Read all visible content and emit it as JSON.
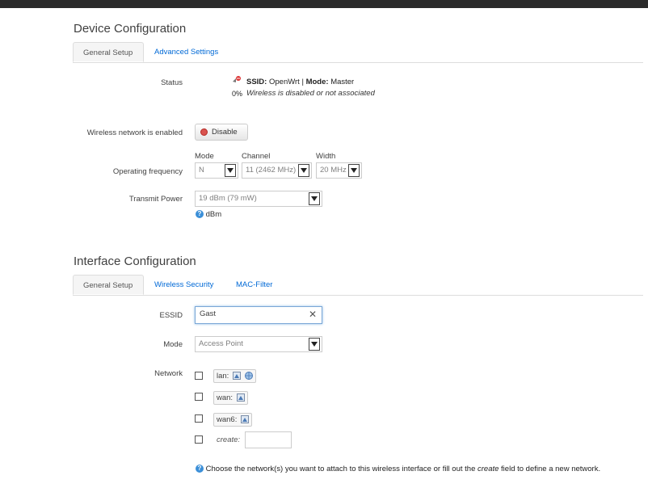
{
  "device": {
    "title": "Device Configuration",
    "tabs": [
      "General Setup",
      "Advanced Settings"
    ],
    "status": {
      "label": "Status",
      "ssid_label": "SSID:",
      "ssid_value": "OpenWrt",
      "sep": "|",
      "mode_label": "Mode:",
      "mode_value": "Master",
      "signal": "0%",
      "message": "Wireless is disabled or not associated"
    },
    "enabled": {
      "label": "Wireless network is enabled",
      "button": "Disable"
    },
    "frequency": {
      "label": "Operating frequency",
      "mode_label": "Mode",
      "mode_value": "N",
      "channel_label": "Channel",
      "channel_value": "11 (2462 MHz)",
      "width_label": "Width",
      "width_value": "20 MHz"
    },
    "transmit": {
      "label": "Transmit Power",
      "value": "19 dBm (79 mW)",
      "hint": "dBm"
    }
  },
  "interface": {
    "title": "Interface Configuration",
    "tabs": [
      "General Setup",
      "Wireless Security",
      "MAC-Filter"
    ],
    "essid": {
      "label": "ESSID",
      "value": "Gast",
      "clear": "✕"
    },
    "mode": {
      "label": "Mode",
      "value": "Access Point"
    },
    "network": {
      "label": "Network",
      "items": [
        {
          "name": "lan:"
        },
        {
          "name": "wan:"
        },
        {
          "name": "wan6:"
        }
      ],
      "create_label": "create:",
      "hint_pre": "Choose the network(s) you want to attach to this wireless interface or fill out the ",
      "hint_em": "create",
      "hint_post": " field to define a new network."
    }
  }
}
